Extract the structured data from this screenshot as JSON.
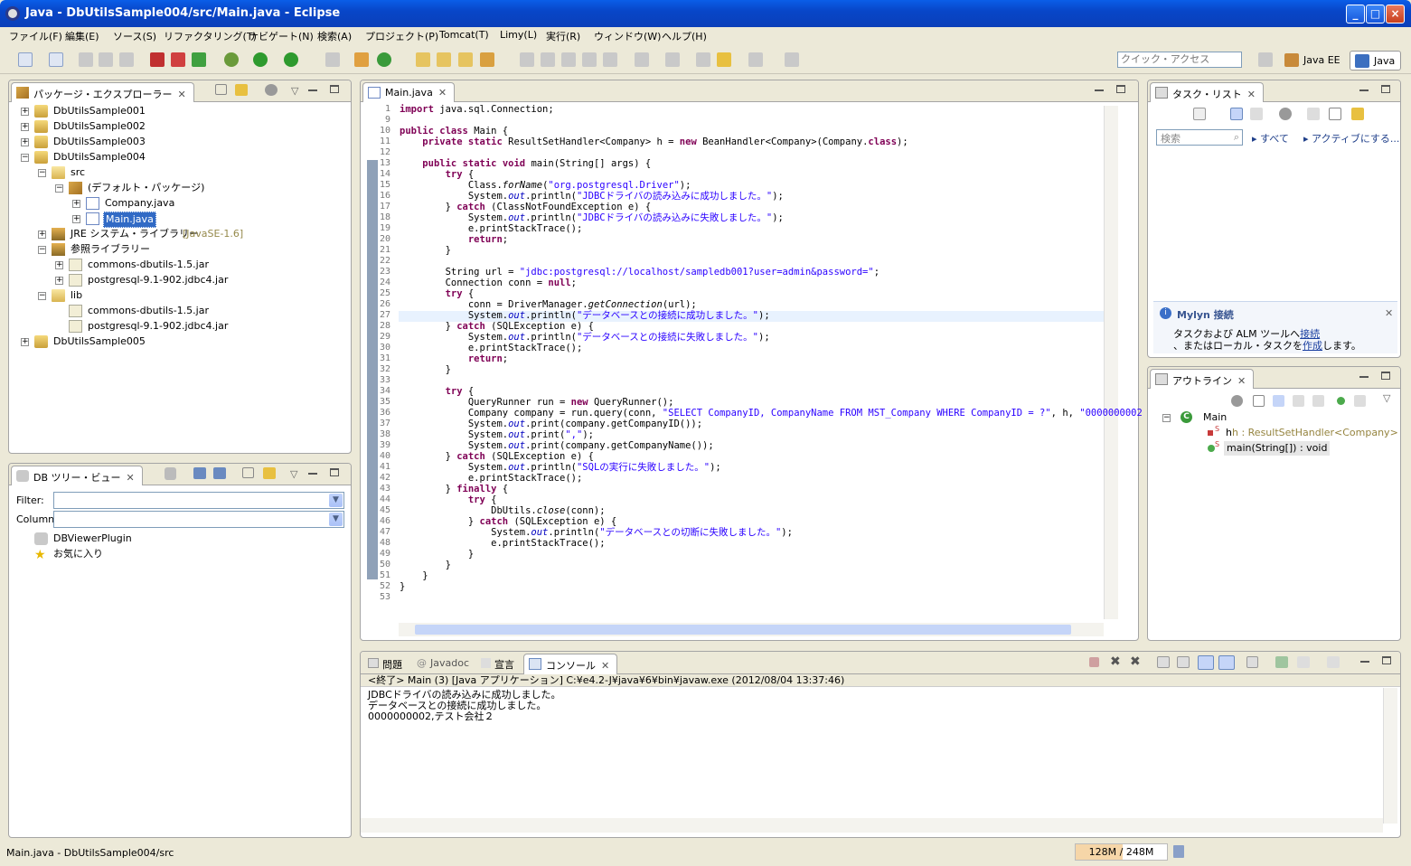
{
  "window": {
    "title": "Java - DbUtilsSample004/src/Main.java - Eclipse"
  },
  "menu": [
    "ファイル(F)",
    "編集(E)",
    "ソース(S)",
    "リファクタリング(T)",
    "ナビゲート(N)",
    "検索(A)",
    "プロジェクト(P)",
    "Tomcat(T)",
    "Limy(L)",
    "実行(R)",
    "ウィンドウ(W)",
    "ヘルプ(H)"
  ],
  "toolbar": {
    "quick_access_placeholder": "クイック・アクセス",
    "perspectives": [
      "Java EE",
      "Java"
    ]
  },
  "package_explorer": {
    "title": "パッケージ・エクスプローラー",
    "tree": [
      {
        "label": "DbUtilsSample001"
      },
      {
        "label": "DbUtilsSample002"
      },
      {
        "label": "DbUtilsSample003"
      },
      {
        "label": "DbUtilsSample004"
      },
      {
        "label": "src"
      },
      {
        "label": "(デフォルト・パッケージ)"
      },
      {
        "label": "Company.java"
      },
      {
        "label": "Main.java"
      },
      {
        "label": "JRE システム・ライブラリー",
        "extra": "[JavaSE-1.6]"
      },
      {
        "label": "参照ライブラリー"
      },
      {
        "label": "commons-dbutils-1.5.jar"
      },
      {
        "label": "postgresql-9.1-902.jdbc4.jar"
      },
      {
        "label": "lib"
      },
      {
        "label": "commons-dbutils-1.5.jar"
      },
      {
        "label": "postgresql-9.1-902.jdbc4.jar"
      },
      {
        "label": "DbUtilsSample005"
      }
    ]
  },
  "db_tree": {
    "title": "DB ツリー・ビュー",
    "filter_label": "Filter:",
    "column_label": "Column:",
    "items": [
      "DBViewerPlugin",
      "お気に入り"
    ]
  },
  "editor": {
    "tab": "Main.java",
    "line_numbers": [
      "1",
      "9",
      "10",
      "11",
      "12",
      "13",
      "14",
      "15",
      "16",
      "17",
      "18",
      "19",
      "20",
      "21",
      "22",
      "23",
      "24",
      "25",
      "26",
      "27",
      "28",
      "29",
      "30",
      "31",
      "32",
      "33",
      "34",
      "35",
      "36",
      "37",
      "38",
      "39",
      "40",
      "41",
      "42",
      "43",
      "44",
      "45",
      "46",
      "47",
      "48",
      "49",
      "50",
      "51",
      "52",
      "53"
    ],
    "lines": [
      "import java.sql.Connection;",
      "",
      "public class Main {",
      "    private static ResultSetHandler<Company> h = new BeanHandler<Company>(Company.class);",
      "",
      "    public static void main(String[] args) {",
      "        try {",
      "            Class.forName(\"org.postgresql.Driver\");",
      "            System.out.println(\"JDBCドライバの読み込みに成功しました。\");",
      "        } catch (ClassNotFoundException e) {",
      "            System.out.println(\"JDBCドライバの読み込みに失敗しました。\");",
      "            e.printStackTrace();",
      "            return;",
      "        }",
      "",
      "        String url = \"jdbc:postgresql://localhost/sampledb001?user=admin&password=\";",
      "        Connection conn = null;",
      "        try {",
      "            conn = DriverManager.getConnection(url);",
      "            System.out.println(\"データベースとの接続に成功しました。\");",
      "        } catch (SQLException e) {",
      "            System.out.println(\"データベースとの接続に失敗しました。\");",
      "            e.printStackTrace();",
      "            return;",
      "        }",
      "",
      "        try {",
      "            QueryRunner run = new QueryRunner();",
      "            Company company = run.query(conn, \"SELECT CompanyID, CompanyName FROM MST_Company WHERE CompanyID = ?\", h, \"0000000002",
      "            System.out.print(company.getCompanyID());",
      "            System.out.print(\",\");",
      "            System.out.print(company.getCompanyName());",
      "        } catch (SQLException e) {",
      "            System.out.println(\"SQLの実行に失敗しました。\");",
      "            e.printStackTrace();",
      "        } finally {",
      "            try {",
      "                DbUtils.close(conn);",
      "            } catch (SQLException e) {",
      "                System.out.println(\"データベースとの切断に失敗しました。\");",
      "                e.printStackTrace();",
      "            }",
      "        }",
      "    }",
      "}",
      ""
    ]
  },
  "task_list": {
    "title": "タスク・リスト",
    "search_placeholder": "検索",
    "all_label": "すべて",
    "active_label": "アクティブにする..."
  },
  "mylyn": {
    "title": "Mylyn 接続",
    "line1_pre": "タスクおよび ALM ツールへ",
    "line1_link": "接続",
    "line2_pre": "、またはローカル・タスクを",
    "line2_link": "作成",
    "line2_post": "します。"
  },
  "outline": {
    "title": "アウトライン",
    "class_name": "Main",
    "field": "h : ResultSetHandler<Company>",
    "method": "main(String[]) : void"
  },
  "bottom_tabs": [
    "問題",
    "Javadoc",
    "宣言",
    "コンソール"
  ],
  "console": {
    "header": "<終了> Main (3) [Java アプリケーション] C:¥e4.2-J¥java¥6¥bin¥javaw.exe (2012/08/04 13:37:46)",
    "lines": [
      "JDBCドライバの読み込みに成功しました。",
      "データベースとの接続に成功しました。",
      "0000000002,テスト会社２"
    ]
  },
  "status": {
    "left": "Main.java - DbUtilsSample004/src",
    "memory": "128M / 248M",
    "memory_used_fraction": 0.516
  }
}
